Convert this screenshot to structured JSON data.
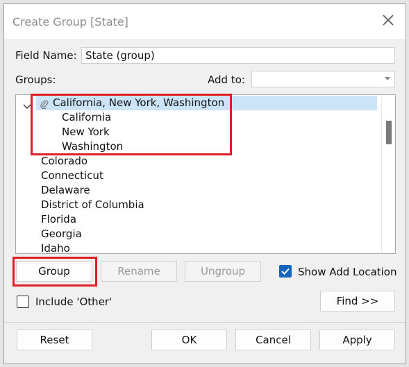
{
  "dialog": {
    "title": "Create Group [State]"
  },
  "field": {
    "label": "Field Name:",
    "value": "State (group)"
  },
  "groups_label": "Groups:",
  "add_to": {
    "label": "Add to:",
    "value": ""
  },
  "tree": {
    "group": {
      "label": "California, New York, Washington",
      "members": [
        "California",
        "New York",
        "Washington"
      ]
    },
    "items": [
      "Colorado",
      "Connecticut",
      "Delaware",
      "District of Columbia",
      "Florida",
      "Georgia",
      "Idaho"
    ]
  },
  "buttons": {
    "group": "Group",
    "rename": "Rename",
    "ungroup": "Ungroup",
    "find": "Find >>",
    "reset": "Reset",
    "ok": "OK",
    "cancel": "Cancel",
    "apply": "Apply"
  },
  "checkboxes": {
    "show_add_location": {
      "label": "Show Add Location",
      "checked": true
    },
    "include_other": {
      "label": "Include 'Other'",
      "checked": false
    }
  },
  "colors": {
    "highlight": "#e11e26",
    "selection": "#cce4f7",
    "checkbox_checked": "#1565c0"
  },
  "icons": {
    "close": "close-icon",
    "expand": "chevron-down-icon",
    "group": "paperclip-icon",
    "dropdown": "dropdown-arrow-icon",
    "check": "checkmark-icon"
  }
}
